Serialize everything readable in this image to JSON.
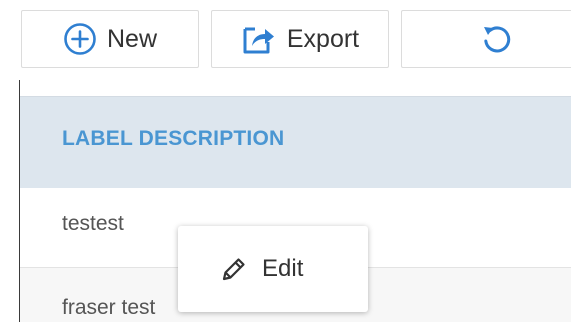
{
  "toolbar": {
    "new_label": "New",
    "new_icon": "plus-circle-icon",
    "export_label": "Export",
    "export_icon": "export-icon",
    "refresh_icon": "refresh-icon",
    "icon_color": "#2f7fd1"
  },
  "table": {
    "columns": [
      "LABEL DESCRIPTION"
    ],
    "rows": [
      {
        "label_description": "testest"
      },
      {
        "label_description": "fraser test"
      }
    ],
    "header_text_color": "#4a96d2",
    "header_bg_color": "#dde6ee"
  },
  "context_menu": {
    "items": [
      {
        "label": "Edit",
        "icon": "pencil-icon"
      }
    ]
  }
}
